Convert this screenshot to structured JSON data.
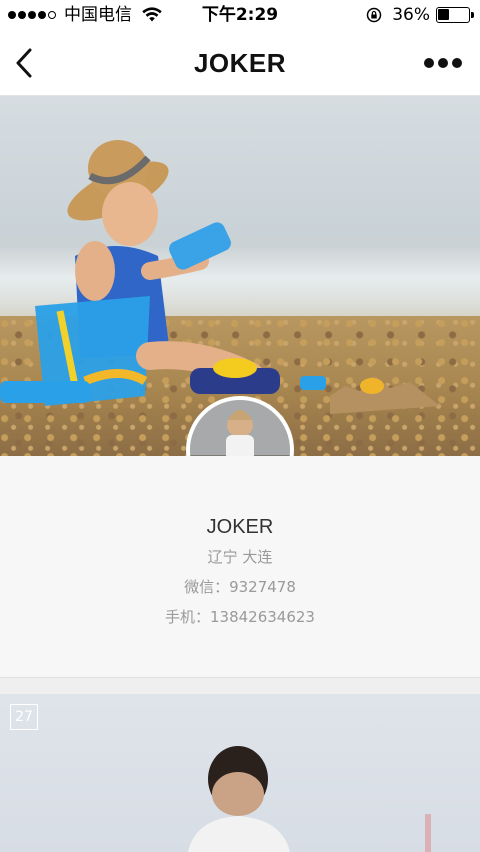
{
  "status_bar": {
    "carrier": "中国电信",
    "time": "下午2:29",
    "battery_percent": "36%",
    "battery_level": 0.36,
    "signal_bars_filled": 4,
    "icons": [
      "signal-dots-icon",
      "wifi-icon",
      "rotation-lock-icon",
      "battery-icon"
    ]
  },
  "nav": {
    "title": "JOKER",
    "back_icon": "chevron-left-icon",
    "more_icon": "more-dots-icon"
  },
  "profile": {
    "name": "JOKER",
    "location": "辽宁 大连",
    "wechat": "微信：9327478",
    "phone": "手机：13842634623"
  },
  "feed": {
    "first_post_date": "27"
  },
  "colors": {
    "nav_bg": "#ffffff",
    "page_bg": "#f5f5f5",
    "secondary_text": "#9a9a9a"
  }
}
